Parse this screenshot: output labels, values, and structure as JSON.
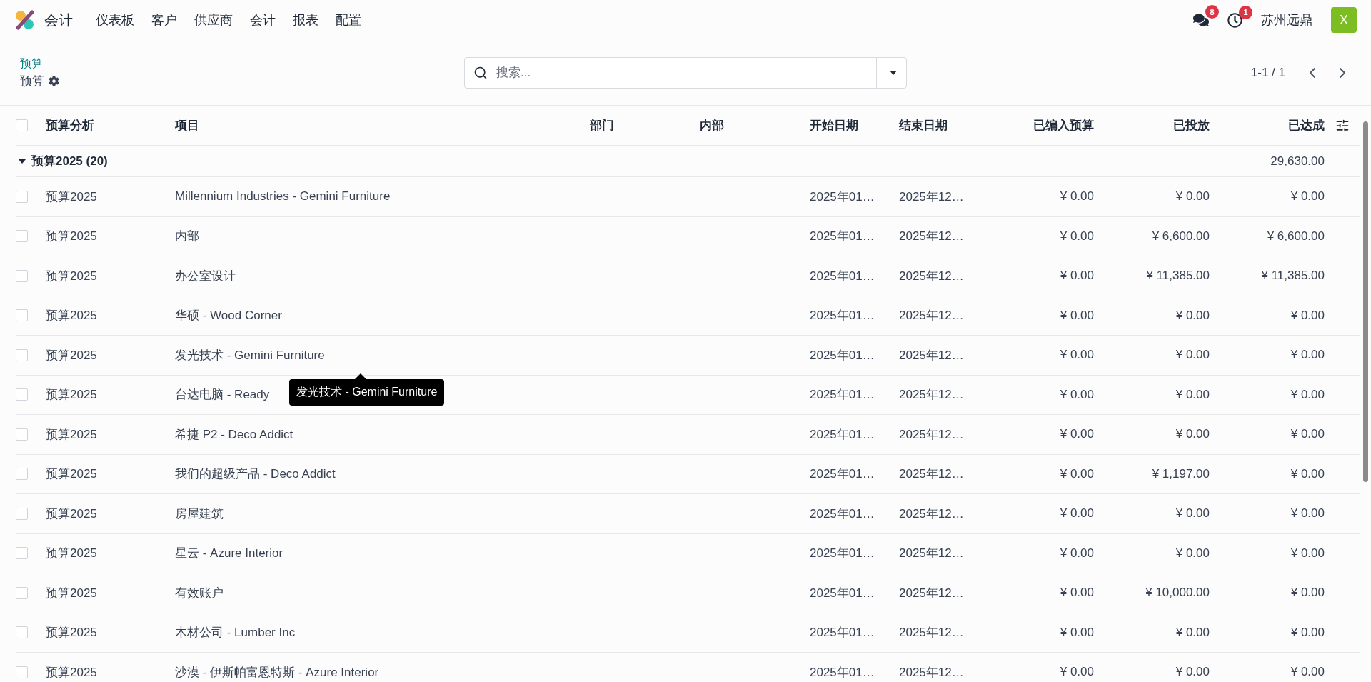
{
  "navbar": {
    "app": "会计",
    "menu": [
      "仪表板",
      "客户",
      "供应商",
      "会计",
      "报表",
      "配置"
    ],
    "messages_count": "8",
    "activities_count": "1",
    "company": "苏州远鼎",
    "avatar": "X"
  },
  "breadcrumb": {
    "parent": "预算",
    "current": "预算"
  },
  "search": {
    "placeholder": "搜索..."
  },
  "pager": "1-1 / 1",
  "table": {
    "header_checked": false,
    "columns": [
      "预算分析",
      "项目",
      "部门",
      "内部",
      "开始日期",
      "结束日期",
      "已编入预算",
      "已投放",
      "已达成"
    ],
    "groups": [
      {
        "label": "预算2025 (20)",
        "expanded": true,
        "total": "29,630.00",
        "rows": [
          {
            "checked": false,
            "analysis": "预算2025",
            "project": "Millennium Industries - Gemini Furniture",
            "start": "2025年01…",
            "end": "2025年12…",
            "budgeted": "¥ 0.00",
            "committed": "¥ 0.00",
            "achieved": "¥ 0.00"
          },
          {
            "checked": false,
            "analysis": "预算2025",
            "project": "内部",
            "start": "2025年01…",
            "end": "2025年12…",
            "budgeted": "¥ 0.00",
            "committed": "¥ 6,600.00",
            "achieved": "¥ 6,600.00"
          },
          {
            "checked": false,
            "analysis": "预算2025",
            "project": "办公室设计",
            "start": "2025年01…",
            "end": "2025年12…",
            "budgeted": "¥ 0.00",
            "committed": "¥ 11,385.00",
            "achieved": "¥ 11,385.00"
          },
          {
            "checked": false,
            "analysis": "预算2025",
            "project": "华硕 - Wood Corner",
            "start": "2025年01…",
            "end": "2025年12…",
            "budgeted": "¥ 0.00",
            "committed": "¥ 0.00",
            "achieved": "¥ 0.00"
          },
          {
            "checked": false,
            "analysis": "预算2025",
            "project": "发光技术 - Gemini Furniture",
            "tooltip": "发光技术 - Gemini Furniture",
            "start": "2025年01…",
            "end": "2025年12…",
            "budgeted": "¥ 0.00",
            "committed": "¥ 0.00",
            "achieved": "¥ 0.00"
          },
          {
            "checked": false,
            "analysis": "预算2025",
            "project": "台达电脑 - Ready",
            "start": "2025年01…",
            "end": "2025年12…",
            "budgeted": "¥ 0.00",
            "committed": "¥ 0.00",
            "achieved": "¥ 0.00"
          },
          {
            "checked": false,
            "analysis": "预算2025",
            "project": "希捷 P2 - Deco Addict",
            "start": "2025年01…",
            "end": "2025年12…",
            "budgeted": "¥ 0.00",
            "committed": "¥ 0.00",
            "achieved": "¥ 0.00"
          },
          {
            "checked": false,
            "analysis": "预算2025",
            "project": "我们的超级产品 - Deco Addict",
            "start": "2025年01…",
            "end": "2025年12…",
            "budgeted": "¥ 0.00",
            "committed": "¥ 1,197.00",
            "achieved": "¥ 0.00"
          },
          {
            "checked": false,
            "analysis": "预算2025",
            "project": "房屋建筑",
            "start": "2025年01…",
            "end": "2025年12…",
            "budgeted": "¥ 0.00",
            "committed": "¥ 0.00",
            "achieved": "¥ 0.00"
          },
          {
            "checked": false,
            "analysis": "预算2025",
            "project": "星云 - Azure Interior",
            "start": "2025年01…",
            "end": "2025年12…",
            "budgeted": "¥ 0.00",
            "committed": "¥ 0.00",
            "achieved": "¥ 0.00"
          },
          {
            "checked": false,
            "analysis": "预算2025",
            "project": "有效账户",
            "start": "2025年01…",
            "end": "2025年12…",
            "budgeted": "¥ 0.00",
            "committed": "¥ 10,000.00",
            "achieved": "¥ 0.00"
          },
          {
            "checked": false,
            "analysis": "预算2025",
            "project": "木材公司 - Lumber Inc",
            "start": "2025年01…",
            "end": "2025年12…",
            "budgeted": "¥ 0.00",
            "committed": "¥ 0.00",
            "achieved": "¥ 0.00"
          },
          {
            "checked": false,
            "analysis": "预算2025",
            "project": "沙漠 - 伊斯帕富恩特斯 - Azure Interior",
            "start": "2025年01…",
            "end": "2025年12…",
            "budgeted": "¥ 0.00",
            "committed": "¥ 0.00",
            "achieved": "¥ 0.00"
          }
        ]
      }
    ]
  }
}
